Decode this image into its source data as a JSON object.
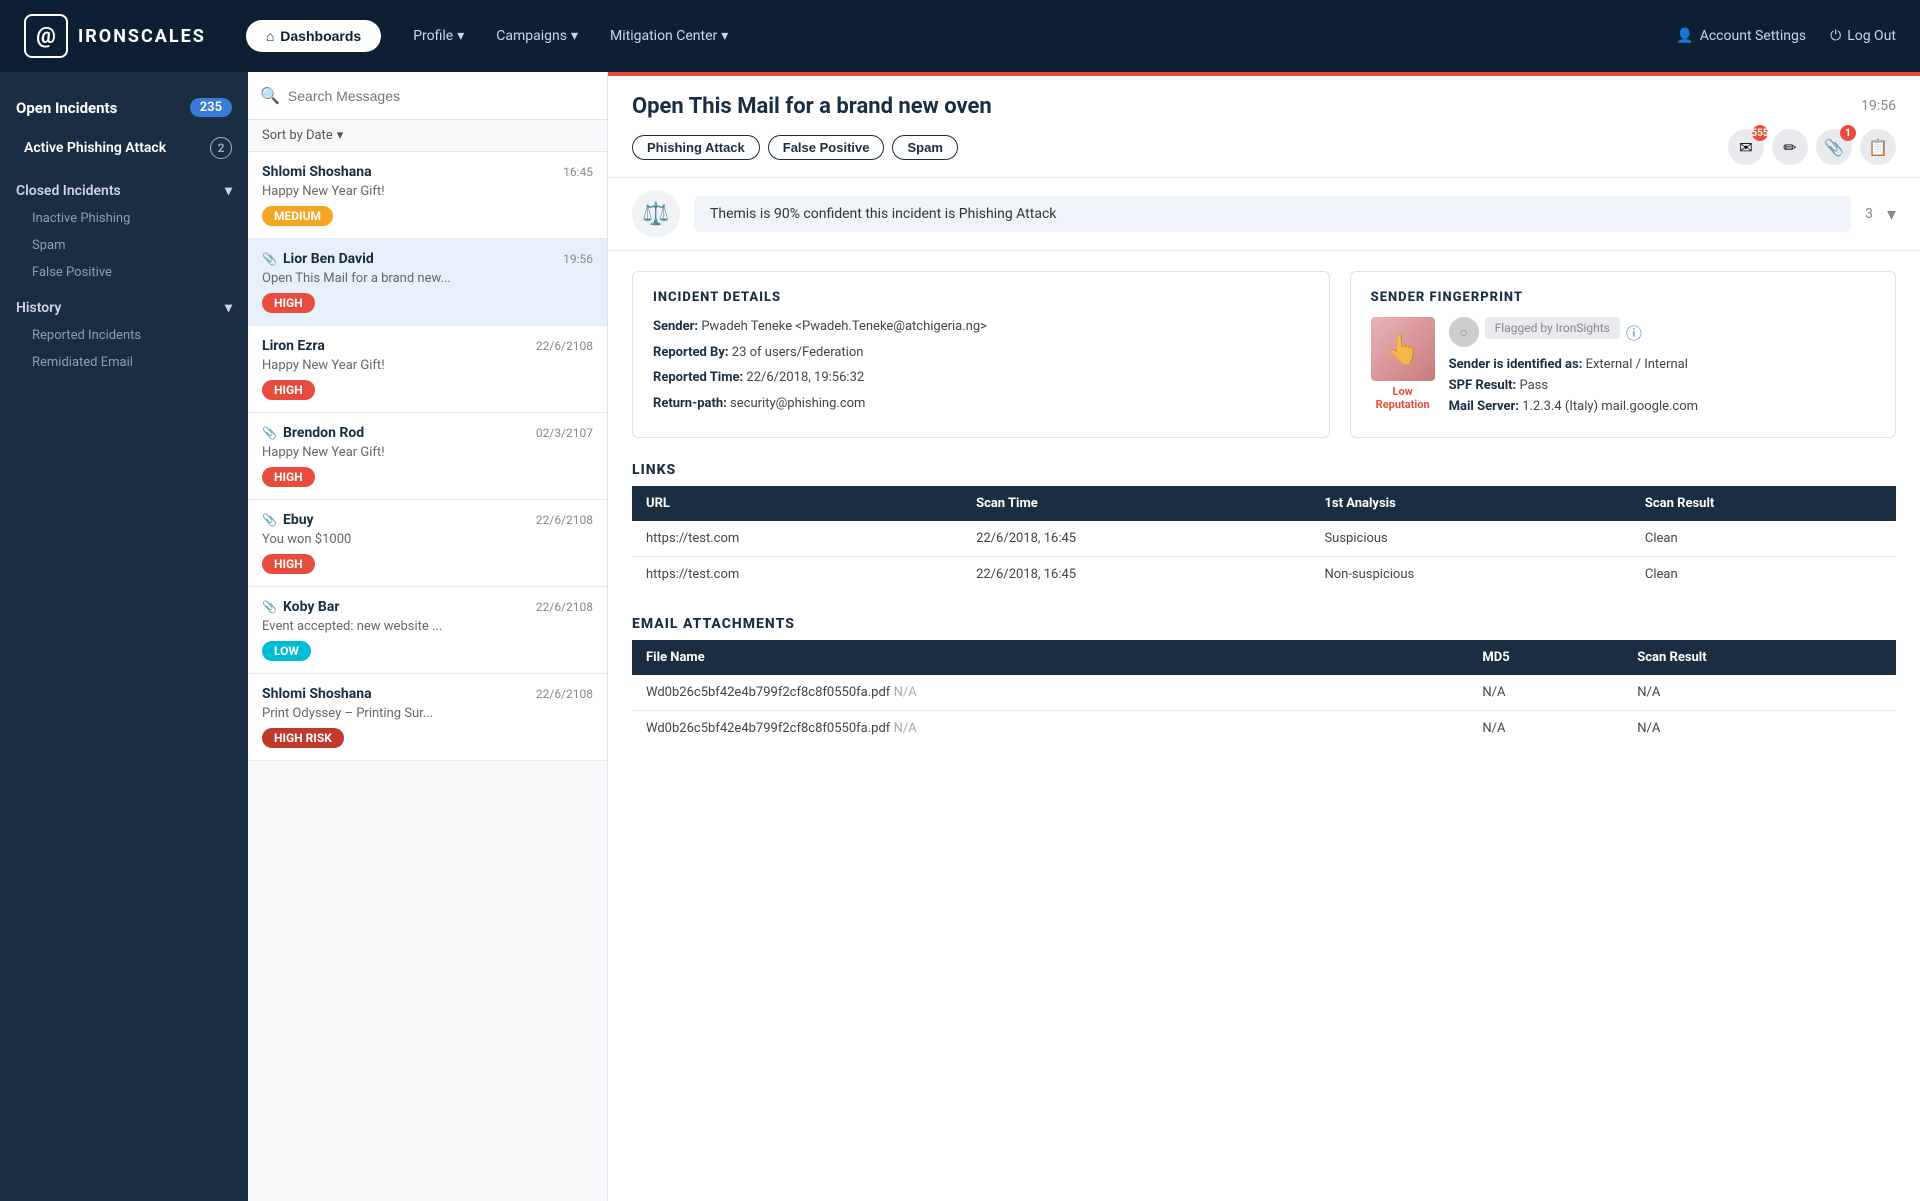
{
  "topnav": {
    "logo_icon": "@",
    "logo_text": "IRONSCALES",
    "nav_active": "Dashboards",
    "nav_items": [
      "Profile",
      "Campaigns",
      "Mitigation Center"
    ],
    "nav_right": [
      "Account Settings",
      "Log Out"
    ]
  },
  "sidebar": {
    "open_incidents_label": "Open Incidents",
    "open_incidents_count": "235",
    "active_phishing_label": "Active Phishing Attack",
    "active_phishing_count": "2",
    "closed_incidents_label": "Closed Incidents",
    "inactive_phishing_label": "Inactive Phishing",
    "spam_label": "Spam",
    "false_positive_label": "False Positive",
    "history_label": "History",
    "reported_incidents_label": "Reported Incidents",
    "remidiated_email_label": "Remidiated Email"
  },
  "message_list": {
    "search_placeholder": "Search Messages",
    "sort_label": "Sort by Date",
    "messages": [
      {
        "sender": "Shlomi Shoshana",
        "time": "16:45",
        "preview": "Happy New Year Gift!",
        "badge": "MEDIUM",
        "badge_class": "badge-medium",
        "has_clip": false
      },
      {
        "sender": "Lior Ben David",
        "time": "19:56",
        "preview": "Open This Mail for a brand new...",
        "badge": "HIGH",
        "badge_class": "badge-high",
        "has_clip": true,
        "selected": true
      },
      {
        "sender": "Liron Ezra",
        "time": "22/6/2108",
        "preview": "Happy New Year Gift!",
        "badge": "HIGH",
        "badge_class": "badge-high",
        "has_clip": false
      },
      {
        "sender": "Brendon Rod",
        "time": "02/3/2107",
        "preview": "Happy New Year Gift!",
        "badge": "HIGH",
        "badge_class": "badge-high",
        "has_clip": true
      },
      {
        "sender": "Ebuy",
        "time": "22/6/2108",
        "preview": "You won $1000",
        "badge": "HIGH",
        "badge_class": "badge-high",
        "has_clip": true
      },
      {
        "sender": "Koby Bar",
        "time": "22/6/2108",
        "preview": "Event accepted: new website ...",
        "badge": "LOW",
        "badge_class": "badge-low",
        "has_clip": true
      },
      {
        "sender": "Shlomi Shoshana",
        "time": "22/6/2108",
        "preview": "Print Odyssey – Printing Sur...",
        "badge": "HIGH RISK",
        "badge_class": "badge-high-risk",
        "has_clip": false
      }
    ]
  },
  "detail": {
    "title": "Open This Mail for a brand new oven",
    "time": "19:56",
    "tags": [
      "Phishing Attack",
      "False Positive",
      "Spam"
    ],
    "icon_count_1": "555",
    "icon_count_2": "1",
    "themis_msg": "Themis is 90% confident this incident is Phishing Attack",
    "themis_count": "3",
    "incident_details": {
      "title": "INCIDENT DETAILS",
      "sender_label": "Sender:",
      "sender_value": "Pwadeh Teneke <Pwadeh.Teneke@atchigeria.ng>",
      "reported_by_label": "Reported By:",
      "reported_by_value": "23 of users/Federation",
      "reported_time_label": "Reported Time:",
      "reported_time_value": "22/6/2018, 19:56:32",
      "return_path_label": "Return-path:",
      "return_path_value": "security@phishing.com"
    },
    "sender_fingerprint": {
      "title": "SENDER FINGERPRINT",
      "flagged_label": "Flagged by IronSights",
      "reputation_label": "Low\nReputation",
      "identified_label": "Sender is identified as:",
      "identified_value": "External / Internal",
      "spf_label": "SPF Result:",
      "spf_value": "Pass",
      "mail_server_label": "Mail Server:",
      "mail_server_value": "1.2.3.4 (Italy) mail.google.com"
    },
    "links": {
      "title": "LINKS",
      "columns": [
        "URL",
        "Scan Time",
        "1st Analysis",
        "Scan Result"
      ],
      "rows": [
        {
          "url": "https://test.com",
          "scan_time": "22/6/2018, 16:45",
          "analysis": "Suspicious",
          "result": "Clean"
        },
        {
          "url": "https://test.com",
          "scan_time": "22/6/2018, 16:45",
          "analysis": "Non-suspicious",
          "result": "Clean"
        }
      ]
    },
    "attachments": {
      "title": "EMAIL ATTACHMENTS",
      "columns": [
        "File Name",
        "MD5",
        "Scan Result"
      ],
      "rows": [
        {
          "filename": "Wd0b26c5bf42e4b799f2cf8c8f0550fa.pdf",
          "md5_label": "N/A",
          "md5": "N/A",
          "result": "N/A"
        },
        {
          "filename": "Wd0b26c5bf42e4b799f2cf8c8f0550fa.pdf",
          "md5_label": "N/A",
          "md5": "N/A",
          "result": "N/A"
        }
      ]
    }
  }
}
